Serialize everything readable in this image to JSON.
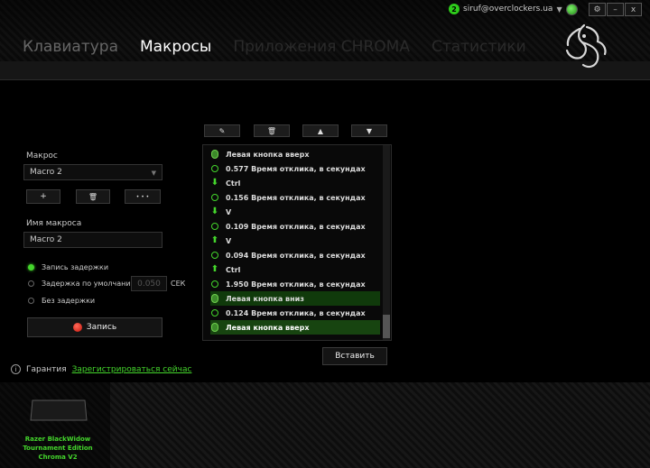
{
  "header": {
    "notifications": "2",
    "user_email": "siruf@overclockers.ua",
    "window_buttons": {
      "settings": "⚙",
      "minimize": "–",
      "close": "x"
    }
  },
  "tabs": [
    {
      "label": "Клавиатура",
      "state": "inactive"
    },
    {
      "label": "Макросы",
      "state": "active"
    },
    {
      "label": "Приложения CHROMA",
      "state": "disabled"
    },
    {
      "label": "Статистики",
      "state": "disabled"
    }
  ],
  "macro": {
    "label": "Макрос",
    "selected": "Macro 2",
    "add_label": "+",
    "delete_label": "🗑",
    "more_label": "• • •",
    "name_label": "Имя макроса",
    "name_value": "Macro 2"
  },
  "delay_options": {
    "record_delay": "Запись задержки",
    "default_delay": "Задержка по умолчанию",
    "default_value": "0.050",
    "unit": "СЕК",
    "no_delay": "Без задержки"
  },
  "record_button": "Запись",
  "list_toolbar": {
    "edit": "✎",
    "delete": "🗑",
    "up": "▲",
    "down": "▼"
  },
  "events": [
    {
      "icon": "mouse-icon",
      "text": "Левая кнопка вверх"
    },
    {
      "icon": "clock-icon",
      "text": "0.577 Время отклика, в секундах"
    },
    {
      "icon": "arrow-down-icon",
      "text": "Ctrl"
    },
    {
      "icon": "clock-icon",
      "text": "0.156 Время отклика, в секундах"
    },
    {
      "icon": "arrow-down-icon",
      "text": "V"
    },
    {
      "icon": "clock-icon",
      "text": "0.109 Время отклика, в секундах"
    },
    {
      "icon": "arrow-up-icon",
      "text": "V"
    },
    {
      "icon": "clock-icon",
      "text": "0.094 Время отклика, в секундах"
    },
    {
      "icon": "arrow-up-icon",
      "text": "Ctrl"
    },
    {
      "icon": "clock-icon",
      "text": "1.950 Время отклика, в секундах"
    },
    {
      "icon": "mouse-icon",
      "text": "Левая кнопка вниз"
    },
    {
      "icon": "clock-icon",
      "text": "0.124 Время отклика, в секундах"
    },
    {
      "icon": "mouse-icon",
      "text": "Левая кнопка вверх"
    }
  ],
  "insert_button": "Вставить",
  "warranty": {
    "label": "Гарантия",
    "link": "Зарегистрироваться сейчас"
  },
  "device": {
    "name_line1": "Razer BlackWidow",
    "name_line2": "Tournament Edition",
    "name_line3": "Chroma V2"
  },
  "colors": {
    "accent": "#44d62c",
    "record": "#d6190b"
  }
}
